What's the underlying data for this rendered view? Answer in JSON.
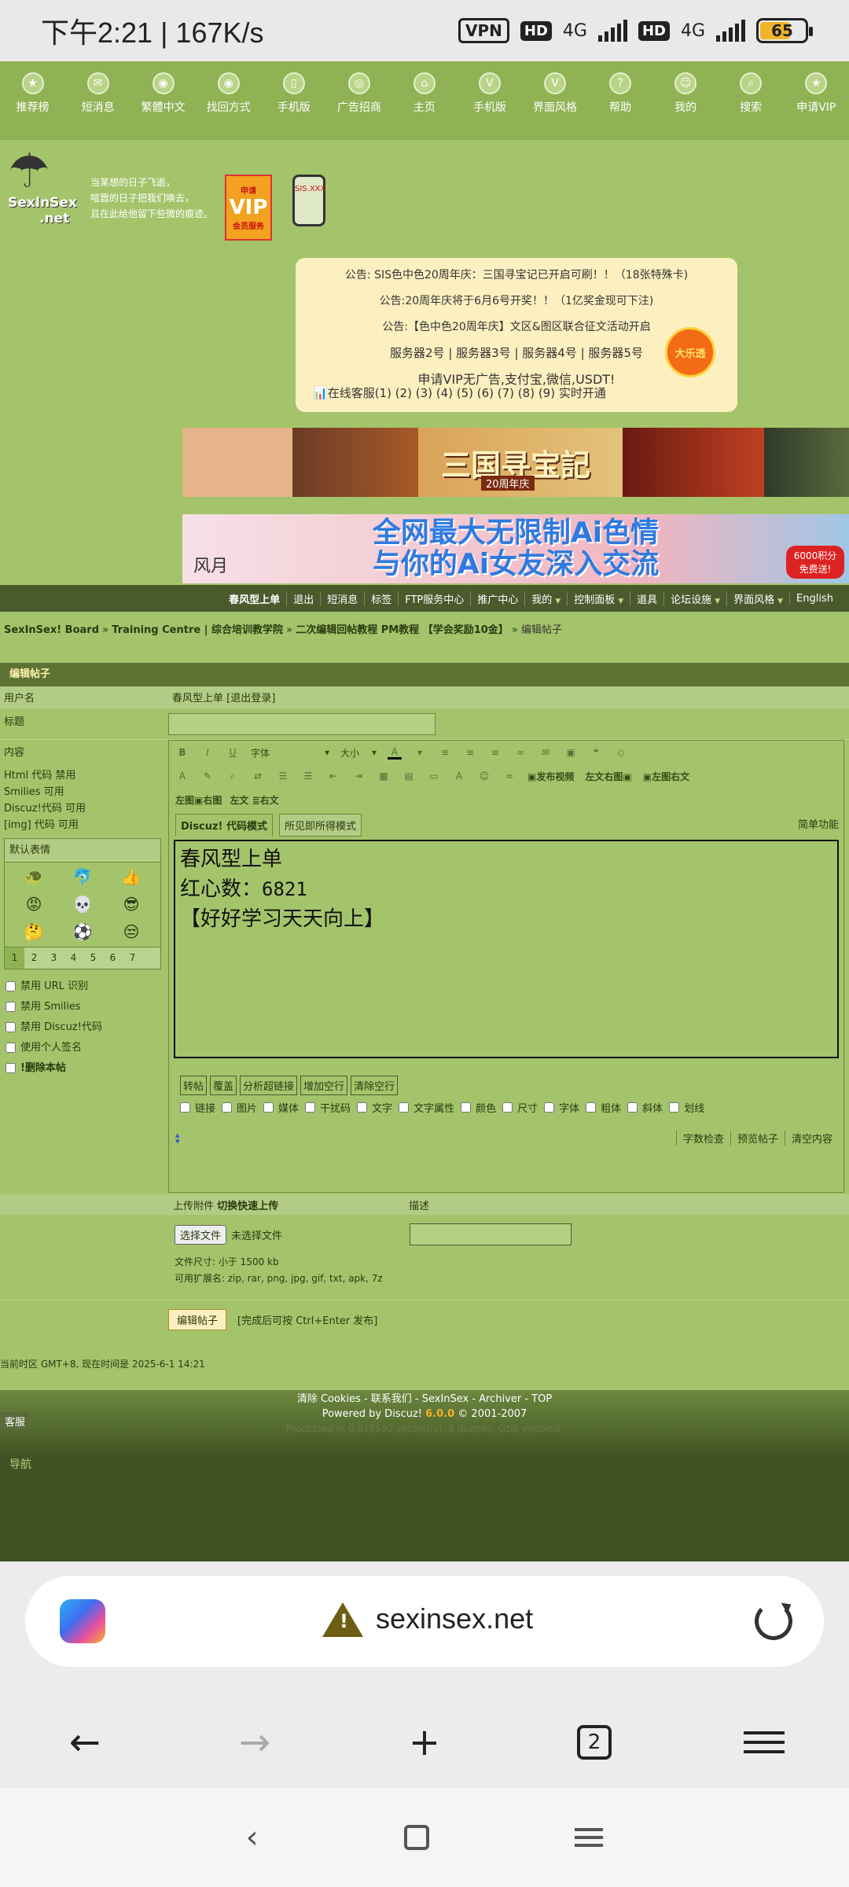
{
  "status_bar": {
    "time": "下午2:21 | 167K/s",
    "vpn": "VPN",
    "hd1": "HD",
    "net1": "4G",
    "hd2": "HD",
    "net2": "4G",
    "battery": "65",
    "battery_level": 0.65
  },
  "top_nav": [
    {
      "label": "推荐榜",
      "icon": "hot-icon"
    },
    {
      "label": "短消息",
      "icon": "mail-icon"
    },
    {
      "label": "繁體中文",
      "icon": "globe-icon"
    },
    {
      "label": "找回方式",
      "icon": "globe-icon"
    },
    {
      "label": "手机版",
      "icon": "phone-icon"
    },
    {
      "label": "广告招商",
      "icon": "ad-icon"
    },
    {
      "label": "主页",
      "icon": "home-icon"
    },
    {
      "label": "手机版",
      "icon": "vip-icon"
    },
    {
      "label": "界面风格",
      "icon": "vip-icon"
    },
    {
      "label": "帮助",
      "icon": "help-icon"
    },
    {
      "label": "我的",
      "icon": "user-icon"
    },
    {
      "label": "搜索",
      "icon": "search-icon"
    },
    {
      "label": "申请VIP",
      "icon": "hot-icon"
    }
  ],
  "header": {
    "logo_name": "SexInSex",
    "logo_sub": ".net",
    "slogan": [
      "当某想的日子飞逝，",
      "喧嚣的日子把我们唤去，",
      "且在此给他留下些微的痕迹。"
    ],
    "vip_top": "申请",
    "vip_big": "VIP",
    "vip_bottom": "会员服务",
    "phone_label": "SIS.XXX"
  },
  "notice": {
    "lines": [
      "公告: SIS色中色20周年庆：三国寻宝记已开启可刷！！（18张特殊卡)",
      "公告:20周年庆将于6月6号开奖！！（1亿奖金现可下注)",
      "公告:【色中色20周年庆】文区&图区联合征文活动开启"
    ],
    "servers": "服务器2号 | 服务器3号 | 服务器4号 | 服务器5号",
    "vip_line": "申请VIP无广告,支付宝,微信,USDT!",
    "online": "在线客服(1) (2) (3) (4) (5) (6) (7) (8) (9) 实时开通",
    "lottery": "大乐透"
  },
  "banner1": {
    "title": "三国寻宝記",
    "sub": "20周年庆"
  },
  "banner2": {
    "line1": "全网最大无限制Ai色情",
    "line2": "与你的Ai女友深入交流",
    "left": "风月",
    "badge": "6000积分 免费送!"
  },
  "menu2": [
    "春风型上单",
    "退出",
    "短消息",
    "标签",
    "FTP服务中心",
    "推广中心",
    "我的",
    "控制面板",
    "道具",
    "论坛设施",
    "界面风格",
    "English"
  ],
  "breadcrumb": {
    "items": [
      "SexInSex! Board",
      "Training Centre | 综合培训教学院",
      "二次编辑回帖教程 PM教程 【学会奖励10金】"
    ],
    "current": "编辑帖子"
  },
  "form": {
    "heading": "编辑帖子",
    "username_label": "用户名",
    "username_value": "春风型上单 [退出登录]",
    "title_label": "标题",
    "content_label": "内容",
    "rules": [
      "Html 代码 禁用",
      "Smilies 可用",
      "Discuz!代码 可用",
      "[img] 代码 可用"
    ],
    "smilies_head": "默认表情",
    "smilies": [
      "🐢",
      "🐬",
      "👍",
      "😡",
      "💀",
      "😎",
      "🤔",
      "⚽",
      "😒"
    ],
    "pages": [
      "1",
      "2",
      "3",
      "4",
      "5",
      "6",
      "7"
    ],
    "checks": [
      "禁用 URL 识别",
      "禁用 Smilies",
      "禁用 Discuz!代码",
      "使用个人签名",
      "!删除本帖"
    ],
    "font_select": "字体",
    "size_select": "大小",
    "word_buttons": [
      "发布视频",
      "左文右图",
      "左图右文"
    ],
    "row3": [
      "左图",
      "右图",
      "左文",
      "右文"
    ],
    "mode_discuz": "Discuz! 代码模式",
    "mode_wysiwyg": "所见即所得模式",
    "simple": "简单功能",
    "content_lines": [
      "春风型上单",
      "红心数：",
      "6821",
      "【好好学习天天向上】"
    ],
    "ops": [
      "转帖",
      "覆盖",
      "分析超链接",
      "增加空行",
      "清除空行"
    ],
    "opts": [
      "链接",
      "图片",
      "媒体",
      "干扰码",
      "文字",
      "文字属性",
      "颜色",
      "尺寸",
      "字体",
      "粗体",
      "斜体",
      "划线"
    ],
    "bottom_buttons": [
      "字数检查",
      "预览帖子",
      "清空内容"
    ],
    "attach_label": "上传附件",
    "attach_switch": "切换快速上传",
    "desc_label": "描述",
    "file_button": "选择文件",
    "file_none": "未选择文件",
    "file_size": "文件尺寸: 小于 1500 kb",
    "file_ext": "可用扩展名: zip, rar, png, jpg, gif, txt, apk, 7z",
    "submit": "编辑帖子",
    "submit_hint": "[完成后可按 Ctrl+Enter 发布]"
  },
  "time_info": "当前时区 GMT+8, 现在时间是 2025-6-1 14:21",
  "footer": {
    "links": "清除 Cookies - 联系我们 - SexInSex - Archiver - TOP",
    "powered": "Powered by Discuz!",
    "version": "6.0.0",
    "copyright": "© 2001-2007",
    "processed": "Processed in 0.019592 second(s), 8 queries, Gzip enabled.",
    "kefu": "客服",
    "daohang": "导航"
  },
  "browser": {
    "url": "sexinsex.net",
    "tabs": "2"
  }
}
